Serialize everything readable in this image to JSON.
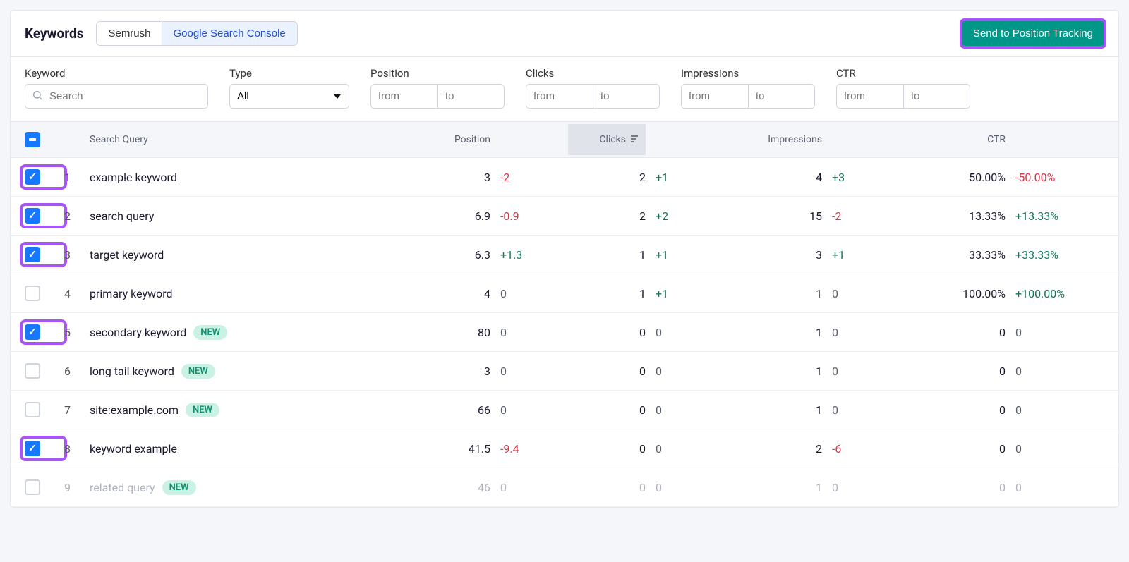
{
  "title": "Keywords",
  "tabs": {
    "semrush": "Semrush",
    "gsc": "Google Search Console"
  },
  "send_button": "Send to Position Tracking",
  "filters": {
    "keyword": {
      "label": "Keyword",
      "placeholder": "Search"
    },
    "type": {
      "label": "Type",
      "value": "All"
    },
    "position": {
      "label": "Position",
      "from": "from",
      "to": "to"
    },
    "clicks": {
      "label": "Clicks",
      "from": "from",
      "to": "to"
    },
    "impressions": {
      "label": "Impressions",
      "from": "from",
      "to": "to"
    },
    "ctr": {
      "label": "CTR",
      "from": "from",
      "to": "to"
    }
  },
  "columns": {
    "search_query": "Search Query",
    "position": "Position",
    "clicks": "Clicks",
    "impressions": "Impressions",
    "ctr": "CTR"
  },
  "rows": [
    {
      "n": "1",
      "checked": true,
      "hl": true,
      "kw": "example keyword",
      "new": false,
      "pos": "3",
      "pos_d": "-2",
      "pos_cls": "neg",
      "clicks": "2",
      "clicks_d": "+1",
      "clicks_cls": "pos",
      "imp": "4",
      "imp_d": "+3",
      "imp_cls": "pos",
      "ctr": "50.00%",
      "ctr_d": "-50.00%",
      "ctr_cls": "neg"
    },
    {
      "n": "2",
      "checked": true,
      "hl": true,
      "kw": "search query",
      "new": false,
      "pos": "6.9",
      "pos_d": "-0.9",
      "pos_cls": "neg",
      "clicks": "2",
      "clicks_d": "+2",
      "clicks_cls": "pos",
      "imp": "15",
      "imp_d": "-2",
      "imp_cls": "neg",
      "ctr": "13.33%",
      "ctr_d": "+13.33%",
      "ctr_cls": "pos"
    },
    {
      "n": "3",
      "checked": true,
      "hl": true,
      "kw": "target keyword",
      "new": false,
      "pos": "6.3",
      "pos_d": "+1.3",
      "pos_cls": "pos",
      "clicks": "1",
      "clicks_d": "+1",
      "clicks_cls": "pos",
      "imp": "3",
      "imp_d": "+1",
      "imp_cls": "pos",
      "ctr": "33.33%",
      "ctr_d": "+33.33%",
      "ctr_cls": "pos"
    },
    {
      "n": "4",
      "checked": false,
      "hl": false,
      "kw": "primary keyword",
      "new": false,
      "pos": "4",
      "pos_d": "0",
      "pos_cls": "zero",
      "clicks": "1",
      "clicks_d": "+1",
      "clicks_cls": "pos",
      "imp": "1",
      "imp_d": "0",
      "imp_cls": "zero",
      "ctr": "100.00%",
      "ctr_d": "+100.00%",
      "ctr_cls": "pos"
    },
    {
      "n": "5",
      "checked": true,
      "hl": true,
      "kw": "secondary keyword",
      "new": true,
      "pos": "80",
      "pos_d": "0",
      "pos_cls": "zero",
      "clicks": "0",
      "clicks_d": "0",
      "clicks_cls": "zero",
      "imp": "1",
      "imp_d": "0",
      "imp_cls": "zero",
      "ctr": "0",
      "ctr_d": "0",
      "ctr_cls": "zero"
    },
    {
      "n": "6",
      "checked": false,
      "hl": false,
      "kw": "long tail keyword",
      "new": true,
      "pos": "3",
      "pos_d": "0",
      "pos_cls": "zero",
      "clicks": "0",
      "clicks_d": "0",
      "clicks_cls": "zero",
      "imp": "1",
      "imp_d": "0",
      "imp_cls": "zero",
      "ctr": "0",
      "ctr_d": "0",
      "ctr_cls": "zero"
    },
    {
      "n": "7",
      "checked": false,
      "hl": false,
      "kw": "site:example.com",
      "new": true,
      "pos": "66",
      "pos_d": "0",
      "pos_cls": "zero",
      "clicks": "0",
      "clicks_d": "0",
      "clicks_cls": "zero",
      "imp": "1",
      "imp_d": "0",
      "imp_cls": "zero",
      "ctr": "0",
      "ctr_d": "0",
      "ctr_cls": "zero"
    },
    {
      "n": "8",
      "checked": true,
      "hl": true,
      "kw": "keyword example",
      "new": false,
      "pos": "41.5",
      "pos_d": "-9.4",
      "pos_cls": "neg",
      "clicks": "0",
      "clicks_d": "0",
      "clicks_cls": "zero",
      "imp": "2",
      "imp_d": "-6",
      "imp_cls": "neg",
      "ctr": "0",
      "ctr_d": "0",
      "ctr_cls": "zero"
    },
    {
      "n": "9",
      "checked": false,
      "hl": false,
      "faded": true,
      "kw": "related query",
      "new": true,
      "pos": "46",
      "pos_d": "0",
      "pos_cls": "zero",
      "clicks": "0",
      "clicks_d": "0",
      "clicks_cls": "zero",
      "imp": "1",
      "imp_d": "0",
      "imp_cls": "zero",
      "ctr": "0",
      "ctr_d": "0",
      "ctr_cls": "zero"
    }
  ],
  "new_label": "NEW"
}
